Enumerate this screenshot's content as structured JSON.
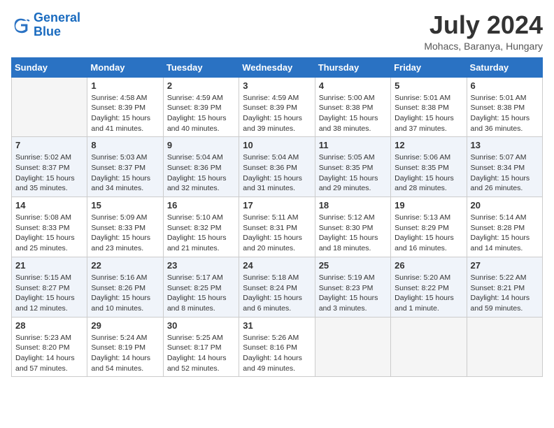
{
  "header": {
    "logo_line1": "General",
    "logo_line2": "Blue",
    "month_title": "July 2024",
    "location": "Mohacs, Baranya, Hungary"
  },
  "days_of_week": [
    "Sunday",
    "Monday",
    "Tuesday",
    "Wednesday",
    "Thursday",
    "Friday",
    "Saturday"
  ],
  "weeks": [
    [
      null,
      {
        "day": 1,
        "sunrise": "4:58 AM",
        "sunset": "8:39 PM",
        "daylight": "15 hours and 41 minutes."
      },
      {
        "day": 2,
        "sunrise": "4:59 AM",
        "sunset": "8:39 PM",
        "daylight": "15 hours and 40 minutes."
      },
      {
        "day": 3,
        "sunrise": "4:59 AM",
        "sunset": "8:39 PM",
        "daylight": "15 hours and 39 minutes."
      },
      {
        "day": 4,
        "sunrise": "5:00 AM",
        "sunset": "8:38 PM",
        "daylight": "15 hours and 38 minutes."
      },
      {
        "day": 5,
        "sunrise": "5:01 AM",
        "sunset": "8:38 PM",
        "daylight": "15 hours and 37 minutes."
      },
      {
        "day": 6,
        "sunrise": "5:01 AM",
        "sunset": "8:38 PM",
        "daylight": "15 hours and 36 minutes."
      }
    ],
    [
      {
        "day": 7,
        "sunrise": "5:02 AM",
        "sunset": "8:37 PM",
        "daylight": "15 hours and 35 minutes."
      },
      {
        "day": 8,
        "sunrise": "5:03 AM",
        "sunset": "8:37 PM",
        "daylight": "15 hours and 34 minutes."
      },
      {
        "day": 9,
        "sunrise": "5:04 AM",
        "sunset": "8:36 PM",
        "daylight": "15 hours and 32 minutes."
      },
      {
        "day": 10,
        "sunrise": "5:04 AM",
        "sunset": "8:36 PM",
        "daylight": "15 hours and 31 minutes."
      },
      {
        "day": 11,
        "sunrise": "5:05 AM",
        "sunset": "8:35 PM",
        "daylight": "15 hours and 29 minutes."
      },
      {
        "day": 12,
        "sunrise": "5:06 AM",
        "sunset": "8:35 PM",
        "daylight": "15 hours and 28 minutes."
      },
      {
        "day": 13,
        "sunrise": "5:07 AM",
        "sunset": "8:34 PM",
        "daylight": "15 hours and 26 minutes."
      }
    ],
    [
      {
        "day": 14,
        "sunrise": "5:08 AM",
        "sunset": "8:33 PM",
        "daylight": "15 hours and 25 minutes."
      },
      {
        "day": 15,
        "sunrise": "5:09 AM",
        "sunset": "8:33 PM",
        "daylight": "15 hours and 23 minutes."
      },
      {
        "day": 16,
        "sunrise": "5:10 AM",
        "sunset": "8:32 PM",
        "daylight": "15 hours and 21 minutes."
      },
      {
        "day": 17,
        "sunrise": "5:11 AM",
        "sunset": "8:31 PM",
        "daylight": "15 hours and 20 minutes."
      },
      {
        "day": 18,
        "sunrise": "5:12 AM",
        "sunset": "8:30 PM",
        "daylight": "15 hours and 18 minutes."
      },
      {
        "day": 19,
        "sunrise": "5:13 AM",
        "sunset": "8:29 PM",
        "daylight": "15 hours and 16 minutes."
      },
      {
        "day": 20,
        "sunrise": "5:14 AM",
        "sunset": "8:28 PM",
        "daylight": "15 hours and 14 minutes."
      }
    ],
    [
      {
        "day": 21,
        "sunrise": "5:15 AM",
        "sunset": "8:27 PM",
        "daylight": "15 hours and 12 minutes."
      },
      {
        "day": 22,
        "sunrise": "5:16 AM",
        "sunset": "8:26 PM",
        "daylight": "15 hours and 10 minutes."
      },
      {
        "day": 23,
        "sunrise": "5:17 AM",
        "sunset": "8:25 PM",
        "daylight": "15 hours and 8 minutes."
      },
      {
        "day": 24,
        "sunrise": "5:18 AM",
        "sunset": "8:24 PM",
        "daylight": "15 hours and 6 minutes."
      },
      {
        "day": 25,
        "sunrise": "5:19 AM",
        "sunset": "8:23 PM",
        "daylight": "15 hours and 3 minutes."
      },
      {
        "day": 26,
        "sunrise": "5:20 AM",
        "sunset": "8:22 PM",
        "daylight": "15 hours and 1 minute."
      },
      {
        "day": 27,
        "sunrise": "5:22 AM",
        "sunset": "8:21 PM",
        "daylight": "14 hours and 59 minutes."
      }
    ],
    [
      {
        "day": 28,
        "sunrise": "5:23 AM",
        "sunset": "8:20 PM",
        "daylight": "14 hours and 57 minutes."
      },
      {
        "day": 29,
        "sunrise": "5:24 AM",
        "sunset": "8:19 PM",
        "daylight": "14 hours and 54 minutes."
      },
      {
        "day": 30,
        "sunrise": "5:25 AM",
        "sunset": "8:17 PM",
        "daylight": "14 hours and 52 minutes."
      },
      {
        "day": 31,
        "sunrise": "5:26 AM",
        "sunset": "8:16 PM",
        "daylight": "14 hours and 49 minutes."
      },
      null,
      null,
      null
    ]
  ]
}
